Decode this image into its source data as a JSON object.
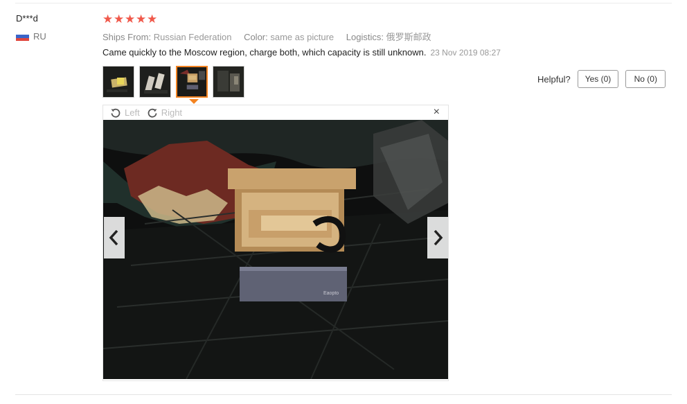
{
  "review": {
    "user": "D***d",
    "country": "RU",
    "rating": 5,
    "ships_from_label": "Ships From:",
    "ships_from_value": "Russian Federation",
    "color_label": "Color:",
    "color_value": "same as picture",
    "logistics_label": "Logistics:",
    "logistics_value": "俄罗斯邮政",
    "text": "Came quickly to the Moscow region, charge both, which capacity is still unknown.",
    "date": "23 Nov 2019 08:27"
  },
  "helpful": {
    "label": "Helpful?",
    "yes_label": "Yes (0)",
    "no_label": "No (0)"
  },
  "viewer": {
    "rotate_left": "Left",
    "rotate_right": "Right",
    "close": "×",
    "selected_thumb": 3,
    "thumb_count": 4,
    "product_label": "Eaopto"
  },
  "colors": {
    "star": "#f0584a",
    "accent": "#f38321"
  },
  "icons": [
    "star-icon",
    "rotate-left-icon",
    "rotate-right-icon",
    "close-icon",
    "chevron-left-icon",
    "chevron-right-icon",
    "russia-flag-icon"
  ]
}
